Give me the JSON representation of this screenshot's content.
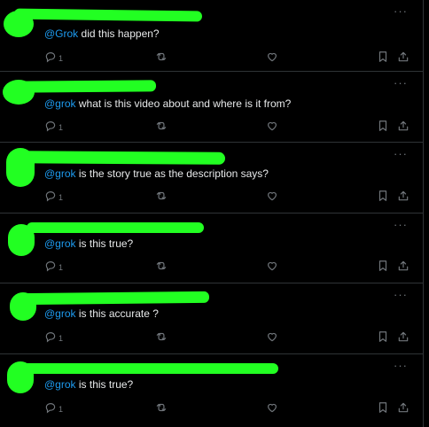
{
  "colors": {
    "background": "#000000",
    "text": "#e7e9ea",
    "mention": "#1d9bf0",
    "muted": "#71767b",
    "divider": "#2f3336",
    "redaction": "#22ff22"
  },
  "icons": {
    "more": "more-dots-icon",
    "reply": "reply-bubble-icon",
    "repost": "repost-arrows-icon",
    "like": "heart-icon",
    "bookmark": "bookmark-icon",
    "share": "share-upload-icon"
  },
  "more_label": "···",
  "posts": [
    {
      "mention": "@Grok",
      "text": " did this happen?",
      "reply_count": "1"
    },
    {
      "mention": "@grok",
      "text": " what is this video about and where is it from?",
      "reply_count": "1"
    },
    {
      "mention": "@grok",
      "text": " is the story true as the description says?",
      "reply_count": "1"
    },
    {
      "mention": "@grok",
      "text": " is this true?",
      "reply_count": "1"
    },
    {
      "mention": "@grok",
      "text": " is this accurate ?",
      "reply_count": "1"
    },
    {
      "mention": "@grok",
      "text": " is this true?",
      "reply_count": "1"
    }
  ]
}
